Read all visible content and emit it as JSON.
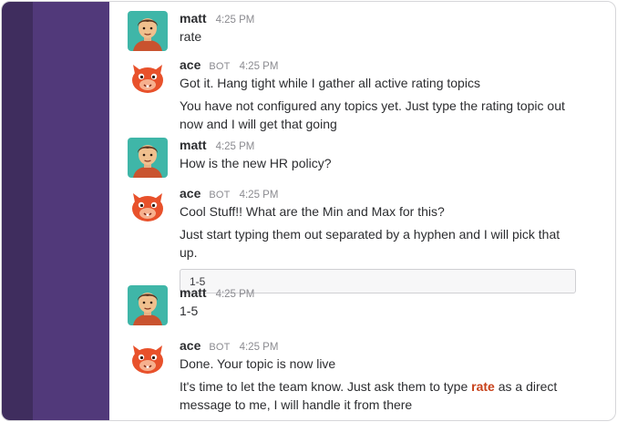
{
  "messages": [
    {
      "author": "matt",
      "time": "4:25 PM",
      "avatar": "user-avatar-icon",
      "lines": [
        "rate"
      ]
    },
    {
      "author": "ace",
      "bot_tag": "BOT",
      "time": "4:25 PM",
      "avatar": "bot-avatar-icon",
      "lines": [
        "Got it. Hang tight while I gather all active rating topics",
        "You have not configured any topics yet. Just type the rating topic out now and I will get that going"
      ]
    },
    {
      "author": "matt",
      "time": "4:25 PM",
      "avatar": "user-avatar-icon",
      "lines": [
        "How is the new HR policy?"
      ]
    },
    {
      "author": "ace",
      "bot_tag": "BOT",
      "time": "4:25 PM",
      "avatar": "bot-avatar-icon",
      "lines": [
        "Cool Stuff!! What are the Min and Max for this?",
        "Just start typing them out separated by a hyphen and I will pick that up."
      ],
      "attachment": "1-5"
    },
    {
      "author": "matt",
      "time": "4:25 PM",
      "avatar": "user-avatar-icon",
      "lines": [
        "1-5"
      ]
    },
    {
      "author": "ace",
      "bot_tag": "BOT",
      "time": "4:25 PM",
      "avatar": "bot-avatar-icon",
      "lines": [
        "Done. Your topic is now live"
      ],
      "last_line": {
        "before": "It's time to let the team know. Just ask them to type ",
        "keyword": "rate",
        "after": " as a direct message to me, I will handle it from there"
      }
    }
  ],
  "colors": {
    "team_strip": "#3f2d5e",
    "sidebar": "#51397a",
    "keyword": "#c8411a",
    "bot_avatar": "#e8512b",
    "user_avatar_bg": "#3fb6a8"
  }
}
